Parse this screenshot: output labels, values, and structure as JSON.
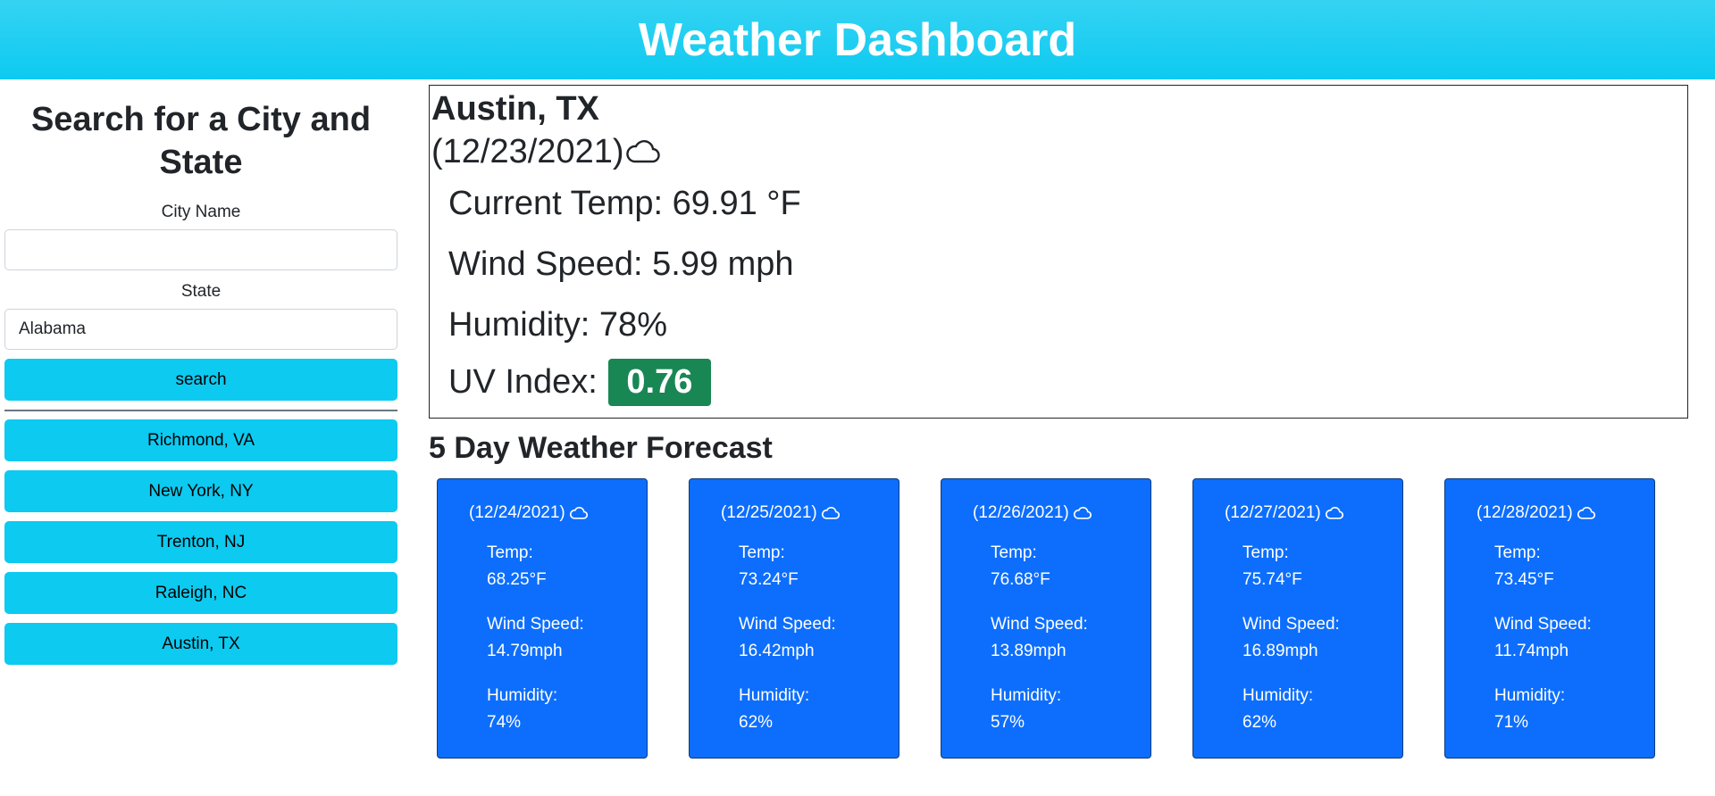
{
  "header": {
    "title": "Weather Dashboard"
  },
  "search": {
    "heading": "Search for a City and State",
    "city_label": "City Name",
    "city_value": "",
    "state_label": "State",
    "state_value": "Alabama",
    "search_button": "search"
  },
  "history": [
    "Richmond, VA",
    "New York, NY",
    "Trenton, NJ",
    "Raleigh, NC",
    "Austin, TX"
  ],
  "current": {
    "city": "Austin, TX",
    "date": "(12/23/2021)",
    "icon": "cloud-icon",
    "temp": "Current Temp: 69.91 °F",
    "wind": "Wind Speed: 5.99 mph",
    "humidity": "Humidity: 78%",
    "uv_label": "UV Index:",
    "uv_value": "0.76",
    "uv_color": "#198754"
  },
  "forecast": {
    "title": "5 Day Weather Forecast",
    "days": [
      {
        "date": "(12/24/2021)",
        "temp_label": "Temp:",
        "temp": "68.25°F",
        "wind_label": "Wind Speed:",
        "wind": "14.79mph",
        "humidity_label": "Humidity:",
        "humidity": "74%"
      },
      {
        "date": "(12/25/2021)",
        "temp_label": "Temp:",
        "temp": "73.24°F",
        "wind_label": "Wind Speed:",
        "wind": "16.42mph",
        "humidity_label": "Humidity:",
        "humidity": "62%"
      },
      {
        "date": "(12/26/2021)",
        "temp_label": "Temp:",
        "temp": "76.68°F",
        "wind_label": "Wind Speed:",
        "wind": "13.89mph",
        "humidity_label": "Humidity:",
        "humidity": "57%"
      },
      {
        "date": "(12/27/2021)",
        "temp_label": "Temp:",
        "temp": "75.74°F",
        "wind_label": "Wind Speed:",
        "wind": "16.89mph",
        "humidity_label": "Humidity:",
        "humidity": "62%"
      },
      {
        "date": "(12/28/2021)",
        "temp_label": "Temp:",
        "temp": "73.45°F",
        "wind_label": "Wind Speed:",
        "wind": "11.74mph",
        "humidity_label": "Humidity:",
        "humidity": "71%"
      }
    ]
  },
  "colors": {
    "header": "#0dcaf0",
    "button": "#0dcaf0",
    "card": "#0d6efd",
    "uv_badge": "#198754"
  }
}
